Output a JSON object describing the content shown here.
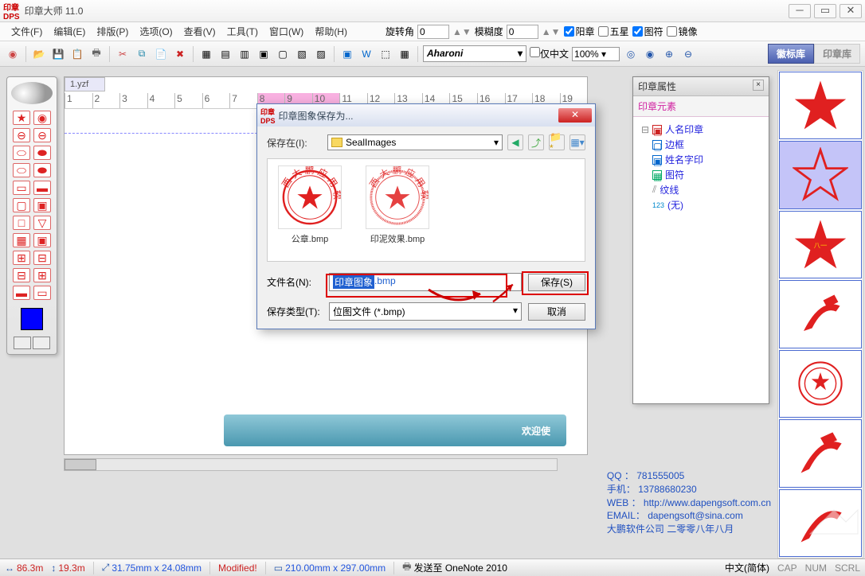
{
  "app": {
    "title": "印章大师 11.0",
    "logo": "印章\nDPS"
  },
  "menu": [
    "文件(F)",
    "编辑(E)",
    "排版(P)",
    "选项(O)",
    "查看(V)",
    "工具(T)",
    "窗口(W)",
    "帮助(H)"
  ],
  "toolbar_opts": {
    "rotate_label": "旋转角",
    "rotate_value": "0",
    "blur_label": "模糊度",
    "blur_value": "0",
    "chk_yang": "阳章",
    "chk_wuxing": "五星",
    "chk_tufu": "图符",
    "chk_jingxiang": "镜像",
    "font": "Aharoni",
    "only_cn": "仅中文",
    "zoom": "100%",
    "lib_emblem": "徽标库",
    "lib_seal": "印章库"
  },
  "document": {
    "tab": "1.yzf",
    "banner": "欢迎使"
  },
  "ruler_ticks": [
    "1",
    "2",
    "3",
    "4",
    "5",
    "6",
    "7",
    "8",
    "9",
    "10",
    "11",
    "12",
    "13",
    "14",
    "15",
    "16",
    "17",
    "18",
    "19"
  ],
  "prop_panel": {
    "title": "印章属性",
    "section": "印章元素",
    "tree": {
      "root": "人名印章",
      "items": [
        "边框",
        "姓名字印",
        "图符",
        "纹线",
        "(无)"
      ]
    }
  },
  "dialog": {
    "title": "印章图象保存为...",
    "save_in_label": "保存在(I):",
    "folder": "SealImages",
    "files": [
      {
        "name": "公章.bmp"
      },
      {
        "name": "印泥效果.bmp"
      }
    ],
    "filename_label": "文件名(N):",
    "filename_value": "印章图象",
    "filename_ext": ".bmp",
    "filetype_label": "保存类型(T):",
    "filetype_value": "位图文件 (*.bmp)",
    "save_btn": "保存(S)",
    "cancel_btn": "取消"
  },
  "contact": {
    "qq": "QQ ： 781555005",
    "phone": "手机： 13788680230",
    "web": "WEB ： http://www.dapengsoft.com.cn",
    "email": "EMAIL： dapengsoft@sina.com",
    "company": "大鹏软件公司  二零零八年八月"
  },
  "status": {
    "x": "86.3m",
    "y": "19.3m",
    "sel": "31.75mm x 24.08mm",
    "modified": "Modified!",
    "page": "210.00mm x 297.00mm",
    "send": "发送至 OneNote 2010",
    "ime": "中文(简体)",
    "caps": "CAP",
    "num": "NUM",
    "scrl": "SCRL"
  }
}
